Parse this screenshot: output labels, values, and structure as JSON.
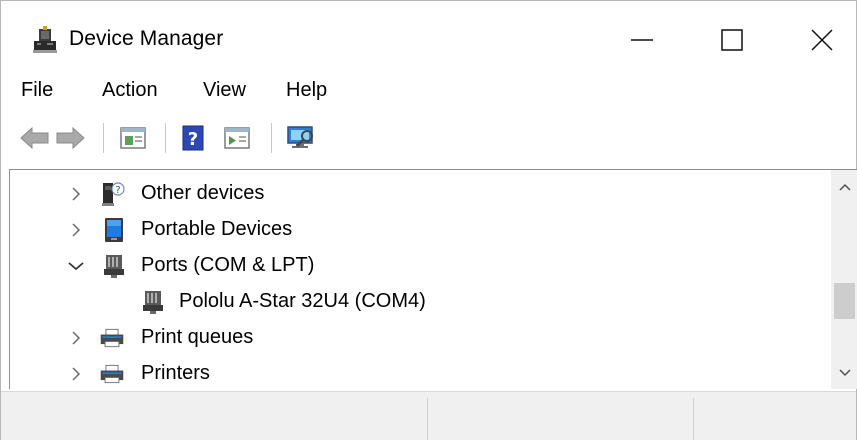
{
  "window": {
    "title": "Device Manager"
  },
  "menu": {
    "file": "File",
    "action": "Action",
    "view": "View",
    "help": "Help"
  },
  "toolbar": {
    "icons": [
      "back-arrow-icon",
      "forward-arrow-icon",
      "properties-icon",
      "help-icon",
      "update-driver-icon",
      "scan-hardware-icon"
    ]
  },
  "tree": {
    "items": [
      {
        "label": "Other devices",
        "expanded": false,
        "icon": "unknown-device-icon"
      },
      {
        "label": "Portable Devices",
        "expanded": false,
        "icon": "portable-device-icon"
      },
      {
        "label": "Ports (COM & LPT)",
        "expanded": true,
        "icon": "port-icon"
      },
      {
        "label": "Pololu A-Star 32U4 (COM4)",
        "child": true,
        "icon": "port-icon"
      },
      {
        "label": "Print queues",
        "expanded": false,
        "icon": "printer-icon"
      },
      {
        "label": "Printers",
        "expanded": false,
        "icon": "printer-icon"
      }
    ]
  },
  "colors": {
    "accent_blue": "#1e7be0",
    "tree_border": "#8e8e8e",
    "statusbar_bg": "#f0f0f0"
  }
}
